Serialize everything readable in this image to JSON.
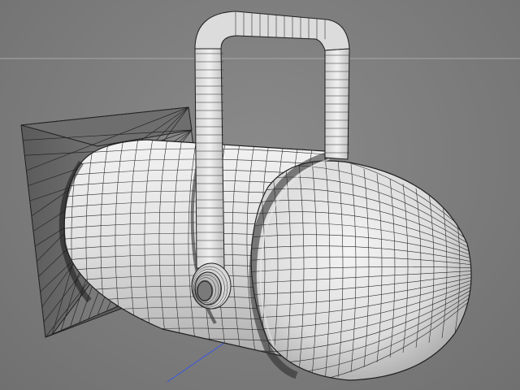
{
  "viewport": {
    "view": "perspective",
    "render_mode": "wireframe-shaded"
  },
  "scene": {
    "object": "par-can-spotlight",
    "parts": [
      "barn-door-frame",
      "can-body",
      "rear-dome",
      "yoke-bracket",
      "pivot-knob"
    ]
  },
  "colors": {
    "background": "#7c7c7c",
    "surface": "#e6e6e6",
    "wire": "#1f1f1f",
    "horizon": "#a8a8a8",
    "axis_x": "#d23a2a",
    "axis_y": "#3fbf3f",
    "axis_z": "#3a56e0"
  }
}
